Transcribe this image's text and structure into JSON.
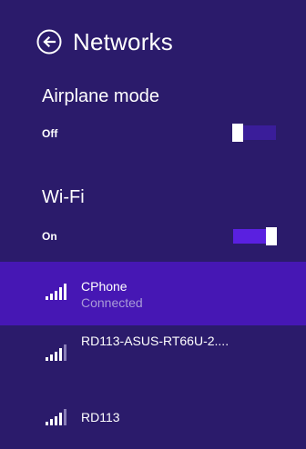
{
  "header": {
    "title": "Networks",
    "back_icon": "back-arrow-circle-icon"
  },
  "airplane": {
    "label": "Airplane mode",
    "state": "Off",
    "is_on": false
  },
  "wifi": {
    "label": "Wi-Fi",
    "state": "On",
    "is_on": true
  },
  "networks": [
    {
      "name": "CPhone",
      "status": "Connected",
      "selected": true
    },
    {
      "name": "RD113-ASUS-RT66U-2....",
      "status": "",
      "selected": false
    },
    {
      "name": "RD113",
      "status": "",
      "selected": false
    }
  ],
  "colors": {
    "background": "#2b1b6b",
    "accent": "#4617b4",
    "toggle_on_track": "#5a20e0",
    "toggle_off_track": "#3a1d9a",
    "status_text": "#a99bd8"
  }
}
